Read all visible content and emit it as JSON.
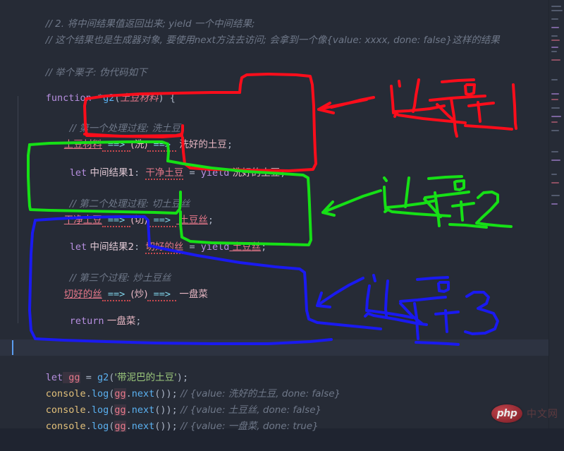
{
  "editor": {
    "background": "#262b36",
    "current_line_background": "#2d3341",
    "font_size_px": 13.5,
    "line_height_px": 23
  },
  "code_lines": [
    {
      "id": 1,
      "indent": 0,
      "kind": "comment",
      "text": "// 2. 将中间结果值返回出来; yield 一个中间结果;"
    },
    {
      "id": 2,
      "indent": 0,
      "kind": "comment",
      "text": "// 这个结果也是生成器对象, 要使用next方法去访问; 会拿到一个像{value: xxxx, done: false}这样的结果"
    },
    {
      "id": 3,
      "indent": 0,
      "kind": "blank",
      "text": ""
    },
    {
      "id": 4,
      "indent": 0,
      "kind": "comment",
      "text": "// 举个栗子: 伪代码如下"
    },
    {
      "id": 5,
      "indent": 0,
      "kind": "blank",
      "text": ""
    },
    {
      "id": 6,
      "indent": 0,
      "kind": "code",
      "text": "function *g2(土豆材料) {"
    },
    {
      "id": 7,
      "indent": 1,
      "kind": "blank",
      "text": ""
    },
    {
      "id": 8,
      "indent": 1,
      "kind": "comment",
      "text": "// 第一个处理过程; 洗土豆"
    },
    {
      "id": 9,
      "indent": 1,
      "kind": "code",
      "text": "土豆材料 ==> (洗) ==>  洗好的土豆;"
    },
    {
      "id": 10,
      "indent": 1,
      "kind": "blank",
      "text": ""
    },
    {
      "id": 11,
      "indent": 1,
      "kind": "code",
      "text": "let 中间结果1: 干净土豆 = yield 洗好的土豆;"
    },
    {
      "id": 12,
      "indent": 1,
      "kind": "blank",
      "text": ""
    },
    {
      "id": 13,
      "indent": 1,
      "kind": "comment",
      "text": "// 第二个处理过程: 切土豆丝"
    },
    {
      "id": 14,
      "indent": 1,
      "kind": "code",
      "text": "干净土豆 ==> (切) ==> 土豆丝;"
    },
    {
      "id": 15,
      "indent": 1,
      "kind": "blank",
      "text": ""
    },
    {
      "id": 16,
      "indent": 1,
      "kind": "code",
      "text": "let 中间结果2: 切好的丝 = yield 土豆丝;"
    },
    {
      "id": 17,
      "indent": 1,
      "kind": "blank",
      "text": ""
    },
    {
      "id": 18,
      "indent": 1,
      "kind": "comment",
      "text": "// 第三个过程: 炒土豆丝"
    },
    {
      "id": 19,
      "indent": 1,
      "kind": "code",
      "text": "切好的丝 ==> (炒) ==> 一盘菜"
    },
    {
      "id": 20,
      "indent": 1,
      "kind": "blank",
      "text": ""
    },
    {
      "id": 21,
      "indent": 1,
      "kind": "code",
      "text": "return 一盘菜;"
    },
    {
      "id": 22,
      "indent": 1,
      "kind": "blank",
      "text": ""
    },
    {
      "id": 23,
      "indent": 0,
      "kind": "code",
      "text": "}"
    },
    {
      "id": 24,
      "indent": 0,
      "kind": "blank",
      "text": ""
    },
    {
      "id": 25,
      "indent": 0,
      "kind": "code",
      "text": "let gg = g2('带泥巴的土豆');"
    },
    {
      "id": 26,
      "indent": 0,
      "kind": "code",
      "text": "console.log(gg.next()); // {value: 洗好的土豆, done: false}"
    },
    {
      "id": 27,
      "indent": 0,
      "kind": "code",
      "text": "console.log(gg.next()); // {value: 土豆丝, done: false}"
    },
    {
      "id": 28,
      "indent": 0,
      "kind": "code",
      "text": "console.log(gg.next()); // {value: 一盘菜, done: true}"
    }
  ],
  "tokens": {
    "l1": {
      "slash": "// 2. ",
      "body": "将中间结果值返回出来; yield 一个中间结果;"
    },
    "l2": {
      "text": "// 这个结果也是生成器对象, 要使用next方法去访问; 会拿到一个像{value: xxxx, done: false}这样的结果"
    },
    "l4": {
      "text": "// 举个栗子: 伪代码如下"
    },
    "l6": {
      "kw": "function",
      "star": " *",
      "name": "g2",
      "paren_open": "(",
      "param": "土豆材料",
      "paren_close": ")",
      "brace": " {"
    },
    "l8": {
      "text": "// 第一个处理过程; 洗土豆"
    },
    "l9": {
      "a": "土豆材料",
      "ar1": " ==> ",
      "b": "(洗)",
      "ar2": " ==> ",
      "c": " 洗好的土豆",
      "semi": ";"
    },
    "l11": {
      "kw": "let",
      "name": " 中间结果1",
      "colon": ": ",
      "type": "干净土豆",
      "eq": " = ",
      "yield": "yield",
      "val": " 洗好的土豆",
      "semi": ";"
    },
    "l13": {
      "text": "// 第二个处理过程: 切土豆丝"
    },
    "l14": {
      "a": "干净土豆",
      "ar1": " ==> ",
      "b": "(切)",
      "ar2": " ==> ",
      "c": " 土豆丝",
      "semi": ";"
    },
    "l16": {
      "kw": "let",
      "name": " 中间结果2",
      "colon": ": ",
      "type": "切好的丝",
      "eq": " = ",
      "yield": "yield",
      "val": " 土豆丝",
      "semi": ";"
    },
    "l18": {
      "text": "// 第三个过程: 炒土豆丝"
    },
    "l19": {
      "a": "切好的丝",
      "ar1": " ==> ",
      "b": "(炒)",
      "ar2": " ==> ",
      "c": " 一盘菜"
    },
    "l21": {
      "kw": "return",
      "val": " 一盘菜",
      "semi": ";"
    },
    "l23": {
      "brace": "}"
    },
    "l25": {
      "kw": "let",
      "var": " gg",
      "eq": " = ",
      "fn": "g2",
      "p1": "(",
      "str": "'带泥巴的土豆'",
      "p2": ")",
      "semi": ";"
    },
    "l26": {
      "obj": "console",
      "dot1": ".",
      "prop": "log",
      "p1": "(",
      "var": "gg",
      "dot2": ".",
      "next": "next",
      "p2": "())",
      "semi": ";",
      "comment": " // {value: 洗好的土豆, done: false}"
    },
    "l27": {
      "obj": "console",
      "dot1": ".",
      "prop": "log",
      "p1": "(",
      "var": "gg",
      "dot2": ".",
      "next": "next",
      "p2": "())",
      "semi": ";",
      "comment": " // {value: 土豆丝, done: false}"
    },
    "l28": {
      "obj": "console",
      "dot1": ".",
      "prop": "log",
      "p1": "(",
      "var": "gg",
      "dot2": ".",
      "next": "next",
      "p2": "())",
      "semi": ";",
      "comment": " // {value: 一盘菜, done: true}"
    }
  },
  "annotations": [
    {
      "id": "proc1",
      "label": "过程1",
      "color": "#fc0d1b",
      "describes_lines": "8-9"
    },
    {
      "id": "proc2",
      "label": "过程2",
      "color": "#16e016",
      "describes_lines": "11-14"
    },
    {
      "id": "proc3",
      "label": "过程3",
      "color": "#1a1af0",
      "describes_lines": "16-21"
    }
  ],
  "watermark": {
    "logo": "php",
    "text": "中文网"
  },
  "colors": {
    "comment": "#6f7889",
    "keyword": "#b78fe0",
    "function": "#5ab0f0",
    "chinese_identifier": "#e6788a",
    "string": "#9ecb7d",
    "object": "#e2c07a",
    "arrow": "#7fd3e8",
    "annotation_red": "#fc0d1b",
    "annotation_green": "#16e016",
    "annotation_blue": "#1a1af0"
  }
}
